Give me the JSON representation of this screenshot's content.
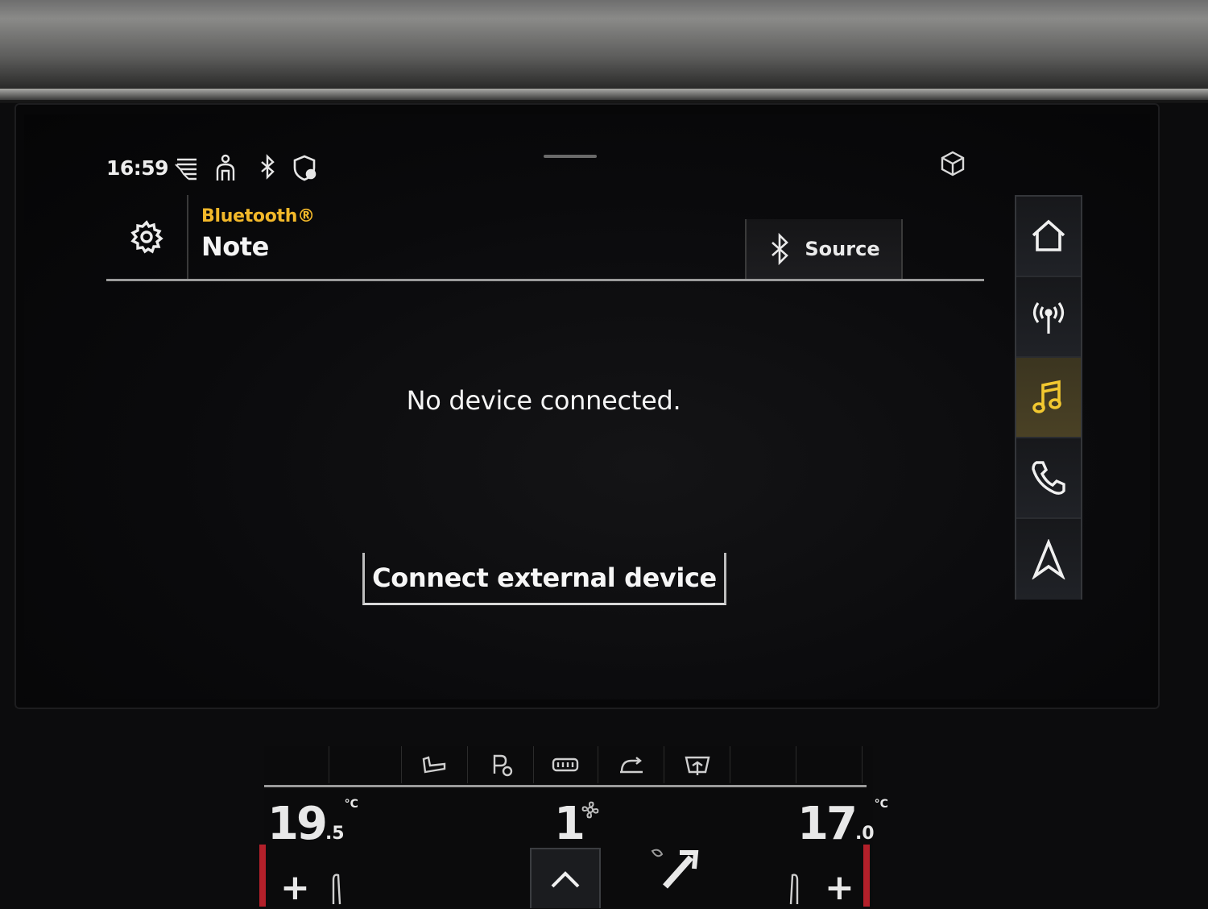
{
  "status_bar": {
    "time": "16:59",
    "icons": [
      "ambient-lighting-icon",
      "driver-profile-icon",
      "bluetooth-icon",
      "security-shield-icon",
      "connect-cube-icon"
    ]
  },
  "header": {
    "settings_icon": "gear-icon",
    "source_name": "Bluetooth®",
    "title": "Note",
    "source_button_label": "Source",
    "source_button_icon": "bluetooth-icon"
  },
  "content": {
    "message": "No device connected.",
    "connect_button_label": "Connect external device"
  },
  "side_nav": {
    "items": [
      {
        "id": "home",
        "icon": "home-icon",
        "active": false
      },
      {
        "id": "radio",
        "icon": "radio-antenna-icon",
        "active": true
      },
      {
        "id": "media",
        "icon": "music-note-icon",
        "active": true
      },
      {
        "id": "phone",
        "icon": "phone-icon",
        "active": false
      },
      {
        "id": "navigation",
        "icon": "navigation-arrow-icon",
        "active": false
      }
    ],
    "active_color": "#f2c830"
  },
  "climate": {
    "left_temp_main": "19",
    "left_temp_decimal": ".5",
    "left_unit": "°C",
    "fan_level": "1",
    "right_temp_main": "17",
    "right_temp_decimal": ".0",
    "right_unit": "°C",
    "plus_left": "+",
    "plus_right": "+"
  },
  "colors": {
    "accent_yellow": "#f2b82a",
    "text_primary": "#f4f4f4",
    "temp_indicator_red": "#b3202a"
  }
}
